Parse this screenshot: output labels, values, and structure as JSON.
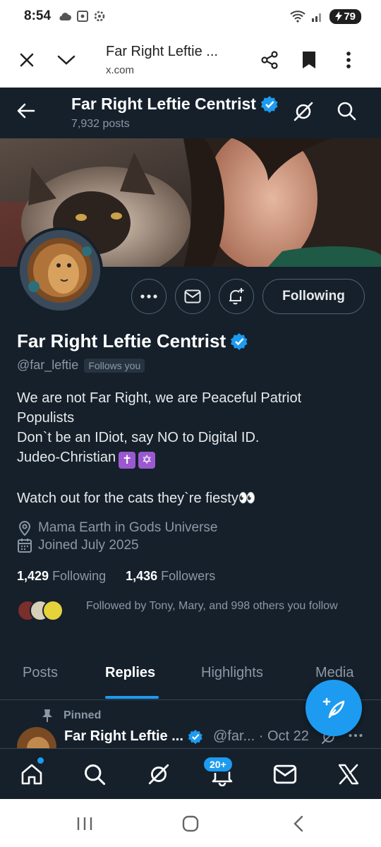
{
  "status_bar": {
    "time": "8:54",
    "battery": "79"
  },
  "browser": {
    "title": "Far Right Leftie ...",
    "url": "x.com"
  },
  "profile_header": {
    "title": "Far Right Leftie Centrist",
    "posts": "7,932 posts"
  },
  "profile": {
    "name": "Far Right Leftie Centrist",
    "handle": "@far_leftie",
    "follows_you": "Follows you",
    "following_button": "Following",
    "bio_lines": [
      "We are not Far Right, we are Peaceful Patriot",
      "Populists",
      "Don`t be an IDiot, say NO to Digital ID.",
      "Judeo-Christian",
      "",
      "Watch out for the cats they`re fiesty👀"
    ],
    "bio_emoji": [
      "✝",
      "✡"
    ],
    "location": "Mama Earth in Gods Universe",
    "joined": "Joined July 2025",
    "following_count": "1,429",
    "following_label": "Following",
    "followers_count": "1,436",
    "followers_label": "Followers",
    "followed_by": "Followed by Tony, Mary, and 998 others you follow"
  },
  "tabs": [
    {
      "label": "Posts",
      "active": false
    },
    {
      "label": "Replies",
      "active": true
    },
    {
      "label": "Highlights",
      "active": false
    },
    {
      "label": "Media",
      "active": false
    }
  ],
  "pinned": {
    "label": "Pinned",
    "author": "Far Right Leftie ...",
    "handle_date": "@far... · Oct 22"
  },
  "bottom_nav": {
    "notification_badge": "20+"
  },
  "colors": {
    "background": "#15202b",
    "accent": "#1d9bf0",
    "verified": "#1d9bf0",
    "muted": "#8b98a5"
  }
}
